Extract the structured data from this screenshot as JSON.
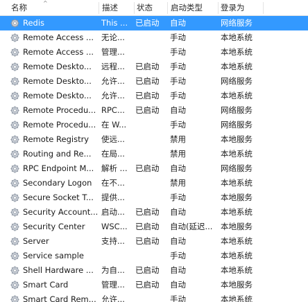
{
  "colors": {
    "selection": "#3399ff",
    "header_border": "#e5e5e5"
  },
  "header": {
    "name": "名称",
    "description": "描述",
    "status": "状态",
    "startup_type": "启动类型",
    "logon_as": "登录为"
  },
  "sort_indicator": "^",
  "services": [
    {
      "name": "Redis",
      "description": "This ...",
      "status": "已启动",
      "startup": "自动",
      "logon": "网络服务",
      "selected": true
    },
    {
      "name": "Remote Access ...",
      "description": "无论...",
      "status": "",
      "startup": "手动",
      "logon": "本地系统"
    },
    {
      "name": "Remote Access ...",
      "description": "管理...",
      "status": "",
      "startup": "手动",
      "logon": "本地系统"
    },
    {
      "name": "Remote Deskto...",
      "description": "远程...",
      "status": "已启动",
      "startup": "手动",
      "logon": "本地系统"
    },
    {
      "name": "Remote Deskto...",
      "description": "允许...",
      "status": "已启动",
      "startup": "手动",
      "logon": "网络服务"
    },
    {
      "name": "Remote Deskto...",
      "description": "允许...",
      "status": "已启动",
      "startup": "手动",
      "logon": "本地系统"
    },
    {
      "name": "Remote Procedu...",
      "description": "RPC...",
      "status": "已启动",
      "startup": "自动",
      "logon": "网络服务"
    },
    {
      "name": "Remote Procedu...",
      "description": "在 W...",
      "status": "",
      "startup": "手动",
      "logon": "网络服务"
    },
    {
      "name": "Remote Registry",
      "description": "使远...",
      "status": "",
      "startup": "禁用",
      "logon": "本地服务"
    },
    {
      "name": "Routing and Re...",
      "description": "在局...",
      "status": "",
      "startup": "禁用",
      "logon": "本地系统"
    },
    {
      "name": "RPC Endpoint M...",
      "description": "解析 ...",
      "status": "已启动",
      "startup": "自动",
      "logon": "网络服务"
    },
    {
      "name": "Secondary Logon",
      "description": "在不...",
      "status": "",
      "startup": "禁用",
      "logon": "本地系统"
    },
    {
      "name": "Secure Socket T...",
      "description": "提供...",
      "status": "",
      "startup": "手动",
      "logon": "本地服务"
    },
    {
      "name": "Security Account...",
      "description": "启动...",
      "status": "已启动",
      "startup": "自动",
      "logon": "本地系统"
    },
    {
      "name": "Security Center",
      "description": "WSC...",
      "status": "已启动",
      "startup": "自动(延迟...",
      "logon": "本地服务"
    },
    {
      "name": "Server",
      "description": "支持...",
      "status": "已启动",
      "startup": "自动",
      "logon": "本地系统"
    },
    {
      "name": "Service sample",
      "description": "",
      "status": "",
      "startup": "手动",
      "logon": "本地系统"
    },
    {
      "name": "Shell Hardware ...",
      "description": "为自...",
      "status": "已启动",
      "startup": "自动",
      "logon": "本地系统"
    },
    {
      "name": "Smart Card",
      "description": "管理...",
      "status": "已启动",
      "startup": "自动",
      "logon": "本地服务"
    },
    {
      "name": "Smart Card Rem...",
      "description": "允许...",
      "status": "",
      "startup": "手动",
      "logon": "本地系统"
    }
  ]
}
